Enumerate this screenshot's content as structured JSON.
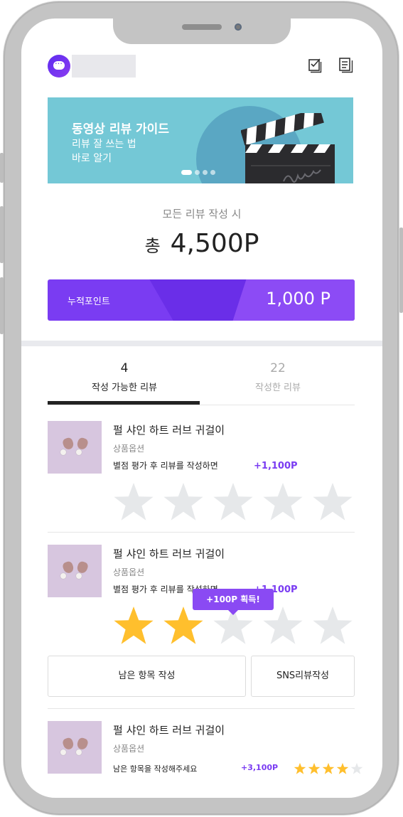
{
  "banner": {
    "title": "동영상 리뷰 가이드",
    "subtitle_line1": "리뷰 잘 쓰는 법",
    "subtitle_line2": "바로 알기",
    "slide_count": 4,
    "active_slide": 1
  },
  "points": {
    "all_review_caption": "모든 리뷰 작성 시",
    "total_prefix": "총",
    "total_value": "4,500P",
    "accumulated_label": "누적포인트",
    "accumulated_value": "1,000 P"
  },
  "tabs": [
    {
      "count": "4",
      "label": "작성 가능한 리뷰",
      "active": true
    },
    {
      "count": "22",
      "label": "작성한 리뷰",
      "active": false
    }
  ],
  "items": [
    {
      "name": "펄 샤인 하트 러브 귀걸이",
      "option": "상품옵션",
      "description": "별점 평가 후 리뷰를 작성하면",
      "reward": "+1,100P",
      "rating": 0,
      "max_rating": 5
    },
    {
      "name": "펄 샤인 하트 러브 귀걸이",
      "option": "상품옵션",
      "description": "별점 평가 후 리뷰를 작성하면",
      "reward": "+1,100P",
      "rating": 2,
      "max_rating": 5,
      "tooltip": "+100P 획득!",
      "button_remaining": "남은 항목 작성",
      "button_sns": "SNS리뷰작성"
    },
    {
      "name": "펄 샤인 하트 러브 귀걸이",
      "option": "상품옵션",
      "description": "남은 항목을 작성해주세요",
      "reward": "+3,100P",
      "rating": 4,
      "max_rating": 5
    }
  ],
  "colors": {
    "accent": "#7a3cf2",
    "star_filled": "#ffbf2d",
    "star_empty": "#e6e8ea",
    "banner_bg": "#74c8d6"
  },
  "icons": [
    "app-logo-icon",
    "checklist-icon",
    "document-list-icon",
    "clapperboard-icon",
    "star-icon"
  ]
}
